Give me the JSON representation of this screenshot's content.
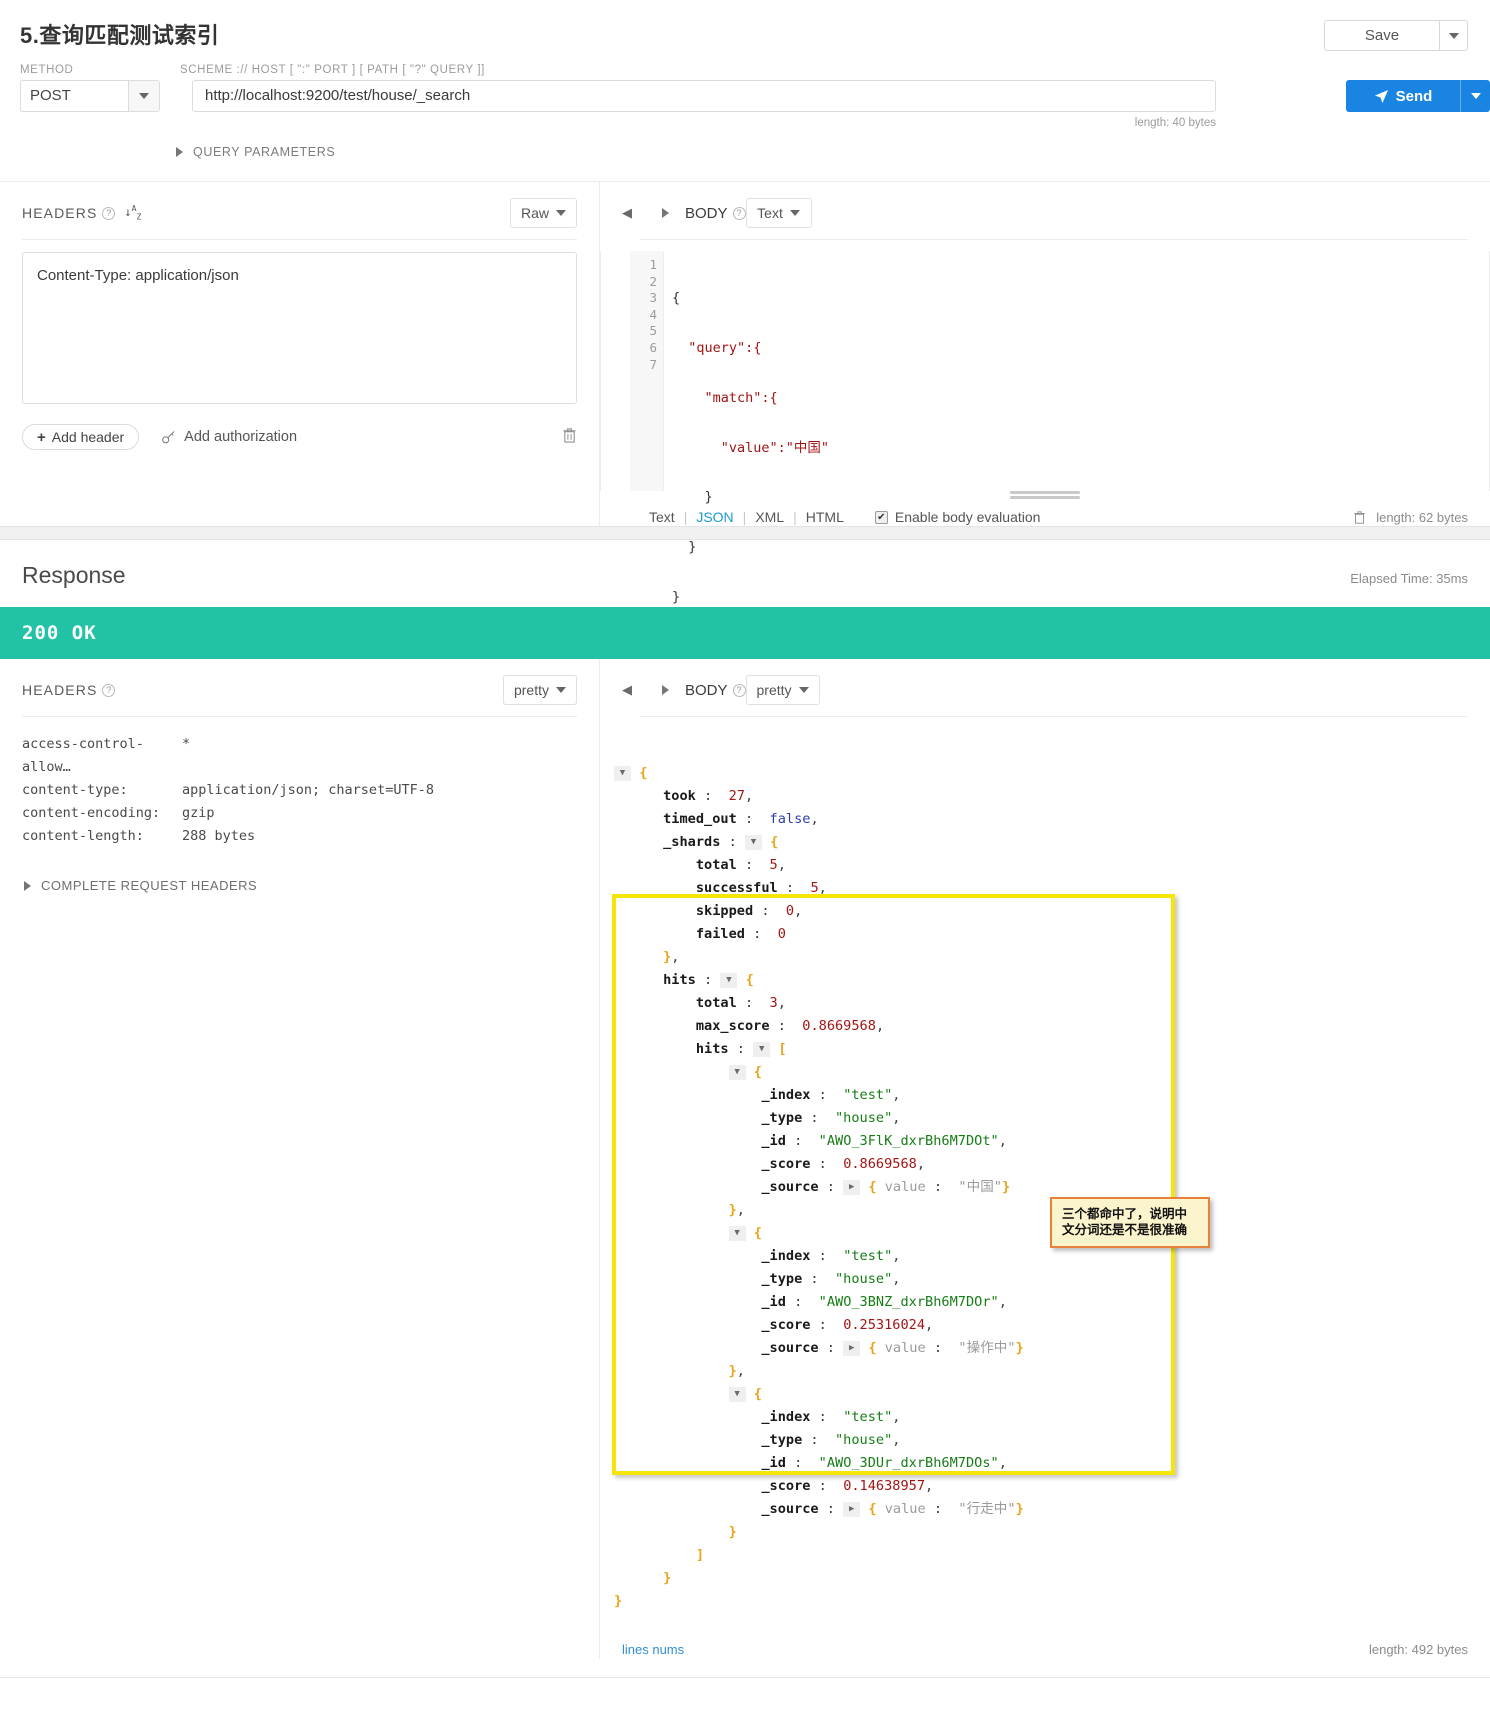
{
  "header": {
    "title": "5.查询匹配测试索引",
    "save_label": "Save"
  },
  "request": {
    "method_label": "METHOD",
    "method_value": "POST",
    "url_label": "SCHEME :// HOST [ \":\" PORT ] [ PATH [ \"?\" QUERY ]]",
    "url_value": "http://localhost:9200/test/house/_search",
    "url_length": "length: 40 bytes",
    "send_label": "Send",
    "query_parameters_label": "QUERY PARAMETERS"
  },
  "req_headers": {
    "title": "HEADERS",
    "view_mode": "Raw",
    "textarea_value": "Content-Type: application/json",
    "add_header_label": "Add header",
    "add_authorization_label": "Add authorization"
  },
  "req_body": {
    "title": "BODY",
    "view_mode": "Text",
    "line_numbers": [
      "1",
      "2",
      "3",
      "4",
      "5",
      "6",
      "7"
    ],
    "code_lines": [
      "{",
      "  \"query\":{",
      "    \"match\":{",
      "      \"value\":\"中国\"",
      "    }",
      "  }",
      "}"
    ],
    "formats": [
      "Text",
      "JSON",
      "XML",
      "HTML"
    ],
    "active_format": "JSON",
    "enable_body_evaluation_label": "Enable body evaluation",
    "enable_body_evaluation_checked": true,
    "length": "length: 62 bytes"
  },
  "response": {
    "title": "Response",
    "elapsed": "Elapsed Time: 35ms",
    "status": "200  OK",
    "status_color": "#22c2a6"
  },
  "resp_headers": {
    "title": "HEADERS",
    "view_mode": "pretty",
    "rows": [
      {
        "key": "access-control-allow…",
        "value": "*"
      },
      {
        "key": "content-type:",
        "value": "application/json; charset=UTF-8"
      },
      {
        "key": "content-encoding:",
        "value": "gzip"
      },
      {
        "key": "content-length:",
        "value": "288 bytes"
      }
    ],
    "complete_request_headers_label": "COMPLETE REQUEST HEADERS"
  },
  "resp_body": {
    "title": "BODY",
    "view_mode": "pretty",
    "lines_nums_label": "lines nums",
    "length": "length: 492 bytes",
    "annotation": "三个都命中了，说明中文分词还是不是很准确",
    "json": {
      "took": 27,
      "timed_out": "false",
      "_shards": {
        "total": 5,
        "successful": 5,
        "skipped": 0,
        "failed": 0
      },
      "hits": {
        "total": 3,
        "max_score": "0.8669568",
        "hits": [
          {
            "_index": "\"test\"",
            "_type": "\"house\"",
            "_id": "\"AWO_3FlK_dxrBh6M7DOt\"",
            "_score": "0.8669568",
            "_source_value": "\"中国\""
          },
          {
            "_index": "\"test\"",
            "_type": "\"house\"",
            "_id": "\"AWO_3BNZ_dxrBh6M7DOr\"",
            "_score": "0.25316024",
            "_source_value": "\"操作中\""
          },
          {
            "_index": "\"test\"",
            "_type": "\"house\"",
            "_id": "\"AWO_3DUr_dxrBh6M7DOs\"",
            "_score": "0.14638957",
            "_source_value": "\"行走中\""
          }
        ]
      }
    }
  }
}
